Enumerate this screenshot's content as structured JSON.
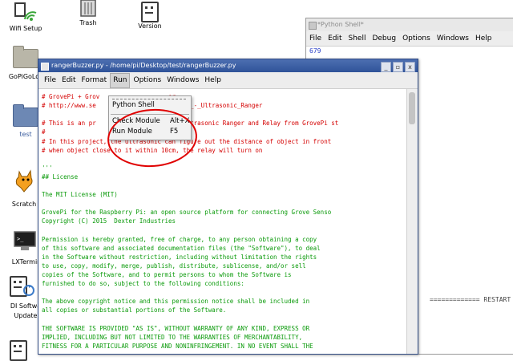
{
  "desktop": {
    "icons": [
      {
        "label": "Wifi Setup"
      },
      {
        "label": "Trash"
      },
      {
        "label": "Version"
      },
      {
        "label": "GoPiGoLo"
      },
      {
        "label": "test"
      },
      {
        "label": "Scratch"
      },
      {
        "label": "LXTermin"
      },
      {
        "label": "DI Softwa"
      },
      {
        "label": "Update"
      }
    ]
  },
  "shell": {
    "title": "*Python Shell*",
    "menu": [
      "File",
      "Edit",
      "Shell",
      "Debug",
      "Options",
      "Windows",
      "Help"
    ],
    "output_line": "679",
    "restart_text": "============= RESTART"
  },
  "editor": {
    "title": "rangerBuzzer.py - /home/pi/Desktop/test/rangerBuzzer.py",
    "buttons": {
      "minimize": "_",
      "maximize": "▫",
      "close": "x"
    },
    "menu": [
      "File",
      "Edit",
      "Format",
      "Run",
      "Options",
      "Windows",
      "Help"
    ],
    "active_menu": "Run",
    "code_lines": [
      {
        "text": "# GrovePi + Grov                   er",
        "color": "red"
      },
      {
        "text": "# http://www.se                    /Grove_-_Ultrasonic_Ranger",
        "color": "red"
      },
      {
        "text": "",
        "color": "red"
      },
      {
        "text": "# This is an pr                    ove Ultrasonic Ranger and Relay from GrovePi st",
        "color": "red"
      },
      {
        "text": "#",
        "color": "red"
      },
      {
        "text": "# In this project, the ultrasonic can figure out the distance of object in front",
        "color": "red"
      },
      {
        "text": "# when object close to it within 10cm, the relay will turn on",
        "color": "red"
      },
      {
        "text": "",
        "color": "green"
      },
      {
        "text": "'''",
        "color": "green"
      },
      {
        "text": "## License",
        "color": "green"
      },
      {
        "text": "",
        "color": "green"
      },
      {
        "text": "The MIT License (MIT)",
        "color": "green"
      },
      {
        "text": "",
        "color": "green"
      },
      {
        "text": "GrovePi for the Raspberry Pi: an open source platform for connecting Grove Senso",
        "color": "green"
      },
      {
        "text": "Copyright (C) 2015  Dexter Industries",
        "color": "green"
      },
      {
        "text": "",
        "color": "green"
      },
      {
        "text": "Permission is hereby granted, free of charge, to any person obtaining a copy",
        "color": "green"
      },
      {
        "text": "of this software and associated documentation files (the \"Software\"), to deal",
        "color": "green"
      },
      {
        "text": "in the Software without restriction, including without limitation the rights",
        "color": "green"
      },
      {
        "text": "to use, copy, modify, merge, publish, distribute, sublicense, and/or sell",
        "color": "green"
      },
      {
        "text": "copies of the Software, and to permit persons to whom the Software is",
        "color": "green"
      },
      {
        "text": "furnished to do so, subject to the following conditions:",
        "color": "green"
      },
      {
        "text": "",
        "color": "green"
      },
      {
        "text": "The above copyright notice and this permission notice shall be included in",
        "color": "green"
      },
      {
        "text": "all copies or substantial portions of the Software.",
        "color": "green"
      },
      {
        "text": "",
        "color": "green"
      },
      {
        "text": "THE SOFTWARE IS PROVIDED \"AS IS\", WITHOUT WARRANTY OF ANY KIND, EXPRESS OR",
        "color": "green"
      },
      {
        "text": "IMPLIED, INCLUDING BUT NOT LIMITED TO THE WARRANTIES OF MERCHANTABILITY,",
        "color": "green"
      },
      {
        "text": "FITNESS FOR A PARTICULAR PURPOSE AND NONINFRINGEMENT. IN NO EVENT SHALL THE",
        "color": "green"
      }
    ]
  },
  "run_menu": {
    "items": [
      {
        "label": "Python Shell",
        "accel": ""
      },
      {
        "label": "Check Module",
        "accel": "Alt+X"
      },
      {
        "label": "Run Module",
        "accel": "F5"
      }
    ]
  },
  "colors": {
    "comment": "#d40000",
    "string": "#0a9a0a",
    "annotation": "#e00000"
  }
}
